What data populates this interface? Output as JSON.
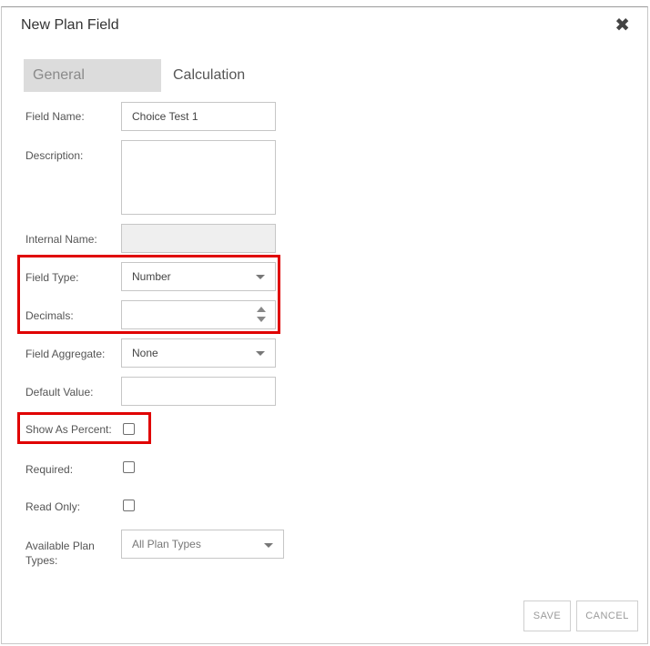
{
  "dialog": {
    "title": "New Plan Field",
    "close_glyph": "✖"
  },
  "tabs": [
    {
      "label": "General",
      "active": true
    },
    {
      "label": "Calculation",
      "active": false
    }
  ],
  "form": {
    "field_name": {
      "label": "Field Name:",
      "value": "Choice Test 1"
    },
    "description": {
      "label": "Description:",
      "value": ""
    },
    "internal_name": {
      "label": "Internal Name:",
      "value": ""
    },
    "field_type": {
      "label": "Field Type:",
      "value": "Number"
    },
    "decimals": {
      "label": "Decimals:",
      "value": ""
    },
    "field_aggregate": {
      "label": "Field Aggregate:",
      "value": "None"
    },
    "default_value": {
      "label": "Default Value:",
      "value": ""
    },
    "show_as_percent": {
      "label": "Show As Percent:",
      "checked": false
    },
    "required": {
      "label": "Required:",
      "checked": false
    },
    "read_only": {
      "label": "Read Only:",
      "checked": false
    },
    "available_plan_types": {
      "label_line1": "Available Plan",
      "label_line2": "Types:",
      "value": "All Plan Types"
    }
  },
  "buttons": {
    "save": "SAVE",
    "cancel": "CANCEL"
  },
  "colors": {
    "highlight": "#e00000",
    "active_tab_bg": "#dcdcdc"
  },
  "icons": {
    "close": "close-icon",
    "dropdown": "chevron-down-icon",
    "spinner": "spinner-arrows-icon"
  }
}
